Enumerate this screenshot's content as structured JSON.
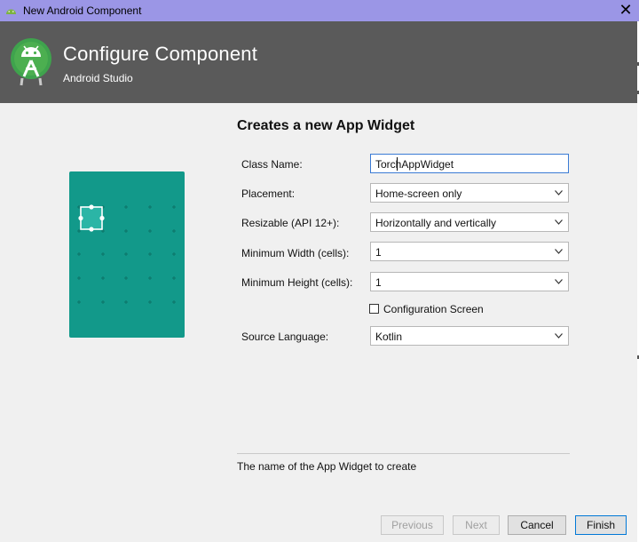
{
  "window": {
    "title": "New Android Component",
    "close_glyph": "✕"
  },
  "header": {
    "title": "Configure Component",
    "subtitle": "Android Studio",
    "logo": "android-studio-logo"
  },
  "form": {
    "heading": "Creates a new App Widget",
    "class_name_label": "Class Name:",
    "class_name_value": "TorchAppWidget",
    "placement_label": "Placement:",
    "placement_value": "Home-screen only",
    "resizable_label": "Resizable (API 12+):",
    "resizable_value": "Horizontally and vertically",
    "min_width_label": "Minimum Width (cells):",
    "min_width_value": "1",
    "min_height_label": "Minimum Height (cells):",
    "min_height_value": "1",
    "config_screen_label": "Configuration Screen",
    "config_screen_checked": false,
    "source_language_label": "Source Language:",
    "source_language_value": "Kotlin"
  },
  "hint": "The name of the App Widget to create",
  "buttons": {
    "previous": "Previous",
    "next": "Next",
    "cancel": "Cancel",
    "finish": "Finish"
  },
  "colors": {
    "titlebar": "#9b96e6",
    "header": "#5a5a5a",
    "preview": "#12998a",
    "accent": "#0078d7"
  }
}
